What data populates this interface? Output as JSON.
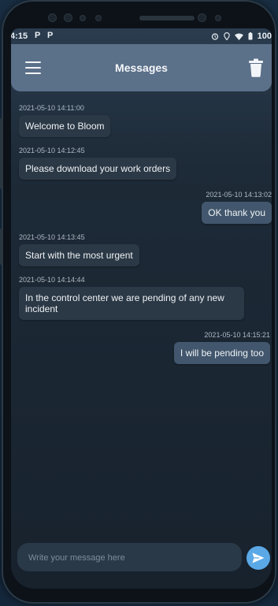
{
  "status_bar": {
    "time": ".4:15",
    "glyph_1": "P",
    "glyph_2": "P",
    "battery": "100"
  },
  "app_bar": {
    "title": "Messages",
    "menu_icon": "hamburger-menu-icon",
    "trash_icon": "trash-icon"
  },
  "messages": [
    {
      "time": "2021-05-10 14:11:00",
      "text": "Welcome to Bloom",
      "direction": "in"
    },
    {
      "time": "2021-05-10 14:12:45",
      "text": "Please download your work orders",
      "direction": "in"
    },
    {
      "time": "2021-05-10 14:13:02",
      "text": "OK thank you",
      "direction": "out"
    },
    {
      "time": "2021-05-10 14:13:45",
      "text": "Start with the most urgent",
      "direction": "in"
    },
    {
      "time": "2021-05-10 14:14:44",
      "text": "In the control center we are pending of any new incident",
      "direction": "in"
    },
    {
      "time": "2021-05-10 14:15:21",
      "text": "I will be pending too",
      "direction": "out"
    }
  ],
  "composer": {
    "placeholder": "Write your message here",
    "send_icon": "send-icon"
  },
  "colors": {
    "app_bar": "#5b7089",
    "incoming_bubble": "#2b3845",
    "outgoing_bubble": "#42576d",
    "send_button": "#5ba8e6"
  }
}
